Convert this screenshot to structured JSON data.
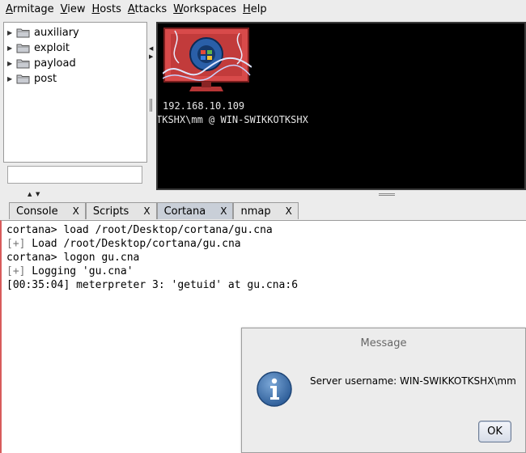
{
  "menu": {
    "items": [
      {
        "mnemonic": "A",
        "rest": "rmitage"
      },
      {
        "mnemonic": "V",
        "rest": "iew"
      },
      {
        "mnemonic": "H",
        "rest": "osts"
      },
      {
        "mnemonic": "A",
        "rest": "ttacks"
      },
      {
        "mnemonic": "W",
        "rest": "orkspaces"
      },
      {
        "mnemonic": "H",
        "rest": "elp"
      }
    ]
  },
  "tree": {
    "items": [
      {
        "label": "auxiliary",
        "icon": "folder-icon"
      },
      {
        "label": "exploit",
        "icon": "folder-icon"
      },
      {
        "label": "payload",
        "icon": "folder-icon"
      },
      {
        "label": "post",
        "icon": "folder-icon"
      }
    ],
    "search_value": ""
  },
  "target": {
    "ip": "192.168.10.109",
    "user_host": "TKSHX\\mm @ WIN-SWIKKOTKSHX"
  },
  "tabs": [
    {
      "label": "Console",
      "close": "X",
      "active": false
    },
    {
      "label": "Scripts",
      "close": "X",
      "active": false
    },
    {
      "label": "Cortana",
      "close": "X",
      "active": true
    },
    {
      "label": "nmap",
      "close": "X",
      "active": false
    }
  ],
  "console": {
    "lines": [
      {
        "prefix": "",
        "text": "cortana> load /root/Desktop/cortana/gu.cna"
      },
      {
        "prefix": "[+]",
        "text": " Load /root/Desktop/cortana/gu.cna"
      },
      {
        "prefix": "",
        "text": "cortana> logon gu.cna"
      },
      {
        "prefix": "[+]",
        "text": " Logging 'gu.cna'"
      },
      {
        "prefix": "",
        "text": "[00:35:04] meterpreter 3: 'getuid' at gu.cna:6"
      }
    ]
  },
  "dialog": {
    "title": "Message",
    "message": "Server username: WIN-SWIKKOTKSHX\\mm",
    "ok_label": "OK"
  },
  "colors": {
    "console_border": "#d85b5b",
    "active_tab": "#c9cfd8",
    "target_bg": "#000000",
    "info_icon": "#3f74ae"
  }
}
